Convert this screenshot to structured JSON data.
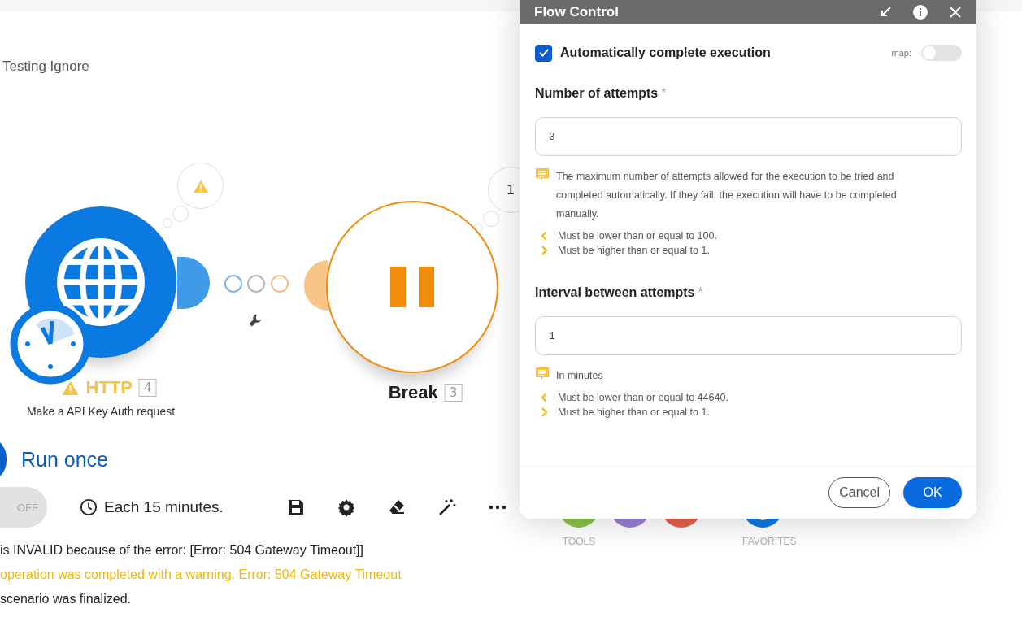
{
  "scenario_title": "Testing Ignore",
  "modules": [
    {
      "kind": "http",
      "name": "HTTP",
      "number": "4",
      "subtitle": "Make a API Key Auth request",
      "warning": true,
      "scheduled": true
    },
    {
      "kind": "break",
      "name": "Break",
      "number": "3"
    }
  ],
  "bubble_count": "1",
  "run_once": "Run once",
  "scheduling": {
    "toggle_label": "OFF",
    "on": false,
    "schedule": "Each 15 minutes."
  },
  "tool_groups": [
    {
      "kind": "tools",
      "label": "TOOLS"
    },
    {
      "kind": "favorites",
      "label": "FAVORITES"
    }
  ],
  "log": [
    {
      "text": "is INVALID because of the error: [Error: 504 Gateway Timeout]]",
      "kind": "info"
    },
    {
      "text": "operation was completed with a warning. Error: 504 Gateway Timeout",
      "kind": "warning"
    },
    {
      "text": "scenario was finalized.",
      "kind": "info"
    }
  ],
  "dialog": {
    "title": "Flow Control",
    "auto_complete": {
      "label": "Automatically complete execution",
      "checked": true
    },
    "map_toggle": {
      "label": "map:",
      "on": false
    },
    "fields": [
      {
        "label": "Number of attempts",
        "required_mark": "*",
        "value": "3",
        "hint": "The maximum number of attempts allowed for the execution to be tried and completed automatically. If they fail, the execution will have to be completed manually.",
        "rules": [
          {
            "kind": "max",
            "text": "Must be lower than or equal to 100."
          },
          {
            "kind": "min",
            "text": "Must be higher than or equal to 1."
          }
        ]
      },
      {
        "label": "Interval between attempts",
        "required_mark": "*",
        "value": "1",
        "hint": "In minutes",
        "rules": [
          {
            "kind": "max",
            "text": "Must be lower than or equal to 44640."
          },
          {
            "kind": "min",
            "text": "Must be higher than or equal to 1."
          }
        ]
      }
    ],
    "buttons": [
      {
        "label": "Cancel",
        "kind": "secondary"
      },
      {
        "label": "OK",
        "kind": "primary"
      }
    ]
  }
}
